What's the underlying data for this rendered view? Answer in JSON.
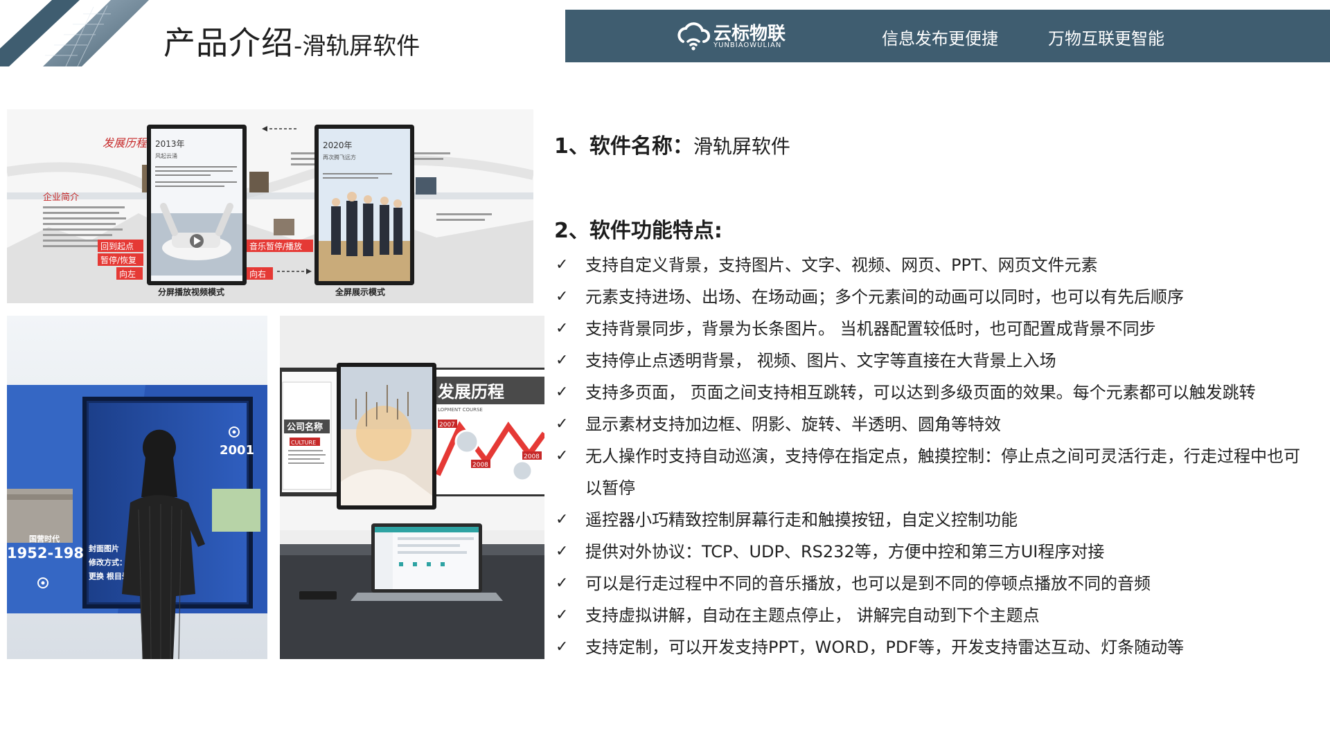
{
  "header": {
    "title_main": "产品介绍",
    "title_sub": "-滑轨屏软件"
  },
  "banner": {
    "logo_cn": "云标物联",
    "logo_en": "YUNBIAOWULIAN",
    "slogan1": "信息发布更便捷",
    "slogan2": "万物互联更智能"
  },
  "colors": {
    "banner": "#3f5d70",
    "accent_red": "#e53935"
  },
  "top_image": {
    "calligraphy": "发展历程",
    "intro_title": "企业简介",
    "left_screen_year": "2013年",
    "left_screen_sub": "风起云涌",
    "right_screen_year": "2020年",
    "right_screen_sub": "再次腾飞远方",
    "btn_start": "回到起点",
    "btn_pause": "暂停/恢复",
    "btn_left": "向左",
    "btn_music": "音乐暂停/播放",
    "btn_right": "向右",
    "caption_left": "分屏播放视频模式",
    "caption_right": "全屏展示模式"
  },
  "bottom_left_image": {
    "year": "2001",
    "era": "国营时代",
    "years": "1952-198",
    "label1": "封面图片",
    "label2": "修改方式：",
    "label3": "更换 根目录 /in"
  },
  "bottom_right_image": {
    "label_company": "公司名称",
    "label_culture": "CULTURE",
    "label_dev": "发展历程",
    "label_dev_en": "LOPMENT COURSE",
    "year_a": "2007",
    "year_b": "2008",
    "year_c": "2008"
  },
  "content": {
    "sec1_label": "1、软件名称：",
    "sec1_value": "滑轨屏软件",
    "sec2_label": "2、软件功能特点:",
    "check_symbol": "✓",
    "features": [
      "支持自定义背景，支持图片、文字、视频、网页、PPT、网页文件元素",
      "元素支持进场、出场、在场动画；多个元素间的动画可以同时，也可以有先后顺序",
      "支持背景同步，背景为长条图片。 当机器配置较低时，也可配置成背景不同步",
      "支持停止点透明背景， 视频、图片、文字等直接在大背景上入场",
      "支持多页面， 页面之间支持相互跳转，可以达到多级页面的效果。每个元素都可以触发跳转",
      "显示素材支持加边框、阴影、旋转、半透明、圆角等特效",
      "无人操作时支持自动巡演，支持停在指定点，触摸控制：停止点之间可灵活行走，行走过程中也可以暂停",
      "遥控器小巧精致控制屏幕行走和触摸按钮，自定义控制功能",
      "提供对外协议：TCP、UDP、RS232等，方便中控和第三方UI程序对接",
      "可以是行走过程中不同的音乐播放，也可以是到不同的停顿点播放不同的音频",
      "支持虚拟讲解，自动在主题点停止， 讲解完自动到下个主题点",
      "支持定制，可以开发支持PPT，WORD，PDF等，开发支持雷达互动、灯条随动等"
    ]
  }
}
